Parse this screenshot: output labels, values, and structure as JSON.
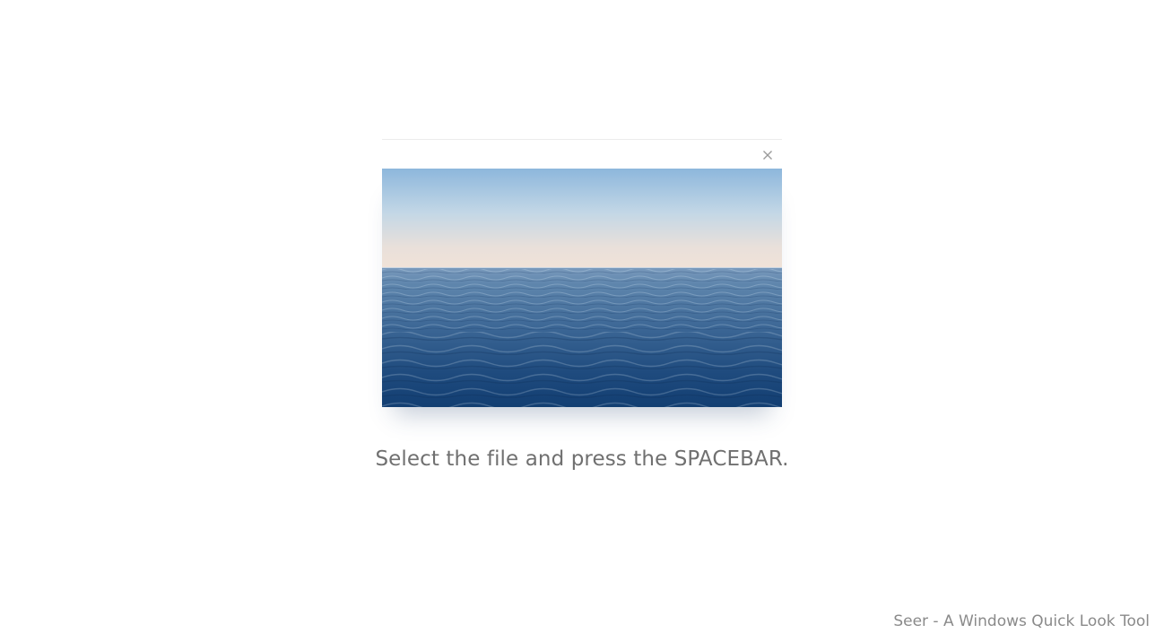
{
  "preview": {
    "close_icon": "close-icon",
    "image_subject": "ocean-horizon-image"
  },
  "instruction": {
    "text": "Select the file and press the SPACEBAR."
  },
  "footer": {
    "app_tagline": "Seer - A Windows Quick Look Tool"
  },
  "colors": {
    "background": "#ffffff",
    "instruction_text": "#707070",
    "footer_text": "#8a8a8a",
    "sky_top": "#8db7dc",
    "sky_horizon": "#f0e2d8",
    "sea_far": "#5f86ad",
    "sea_near": "#123e72"
  }
}
